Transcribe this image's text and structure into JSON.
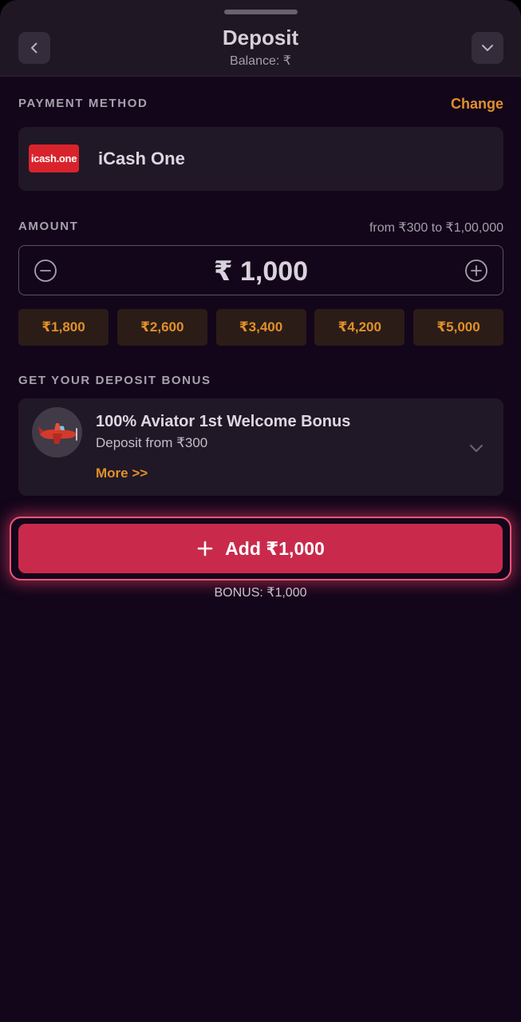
{
  "header": {
    "title": "Deposit",
    "balance": "Balance: ₹",
    "back_icon": "chevron-left-icon",
    "collapse_icon": "chevron-down-icon"
  },
  "payment_method": {
    "label": "PAYMENT METHOD",
    "change_label": "Change",
    "logo_text": "icash.one",
    "name": "iCash One"
  },
  "amount": {
    "label": "AMOUNT",
    "range": "from ₹300 to ₹1,00,000",
    "value": "₹ 1,000",
    "minus_icon": "minus-circle-icon",
    "plus_icon": "plus-circle-icon",
    "presets": [
      "₹1,800",
      "₹2,600",
      "₹3,400",
      "₹4,200",
      "₹5,000"
    ]
  },
  "bonus": {
    "label": "GET YOUR DEPOSIT BONUS",
    "title": "100% Aviator 1st Welcome Bonus",
    "subtitle": "Deposit from ₹300",
    "more": "More >>",
    "icon": "airplane-icon",
    "expand_icon": "chevron-down-icon"
  },
  "submit": {
    "label": "Add ₹1,000",
    "icon": "plus-icon",
    "bonus_note": "BONUS: ₹1,000"
  },
  "colors": {
    "background": "#13061a",
    "card": "#201826",
    "accent_orange": "#e0902a",
    "primary_button": "#c92a4c",
    "button_glow": "#f0557a",
    "logo_red": "#d9232c"
  }
}
